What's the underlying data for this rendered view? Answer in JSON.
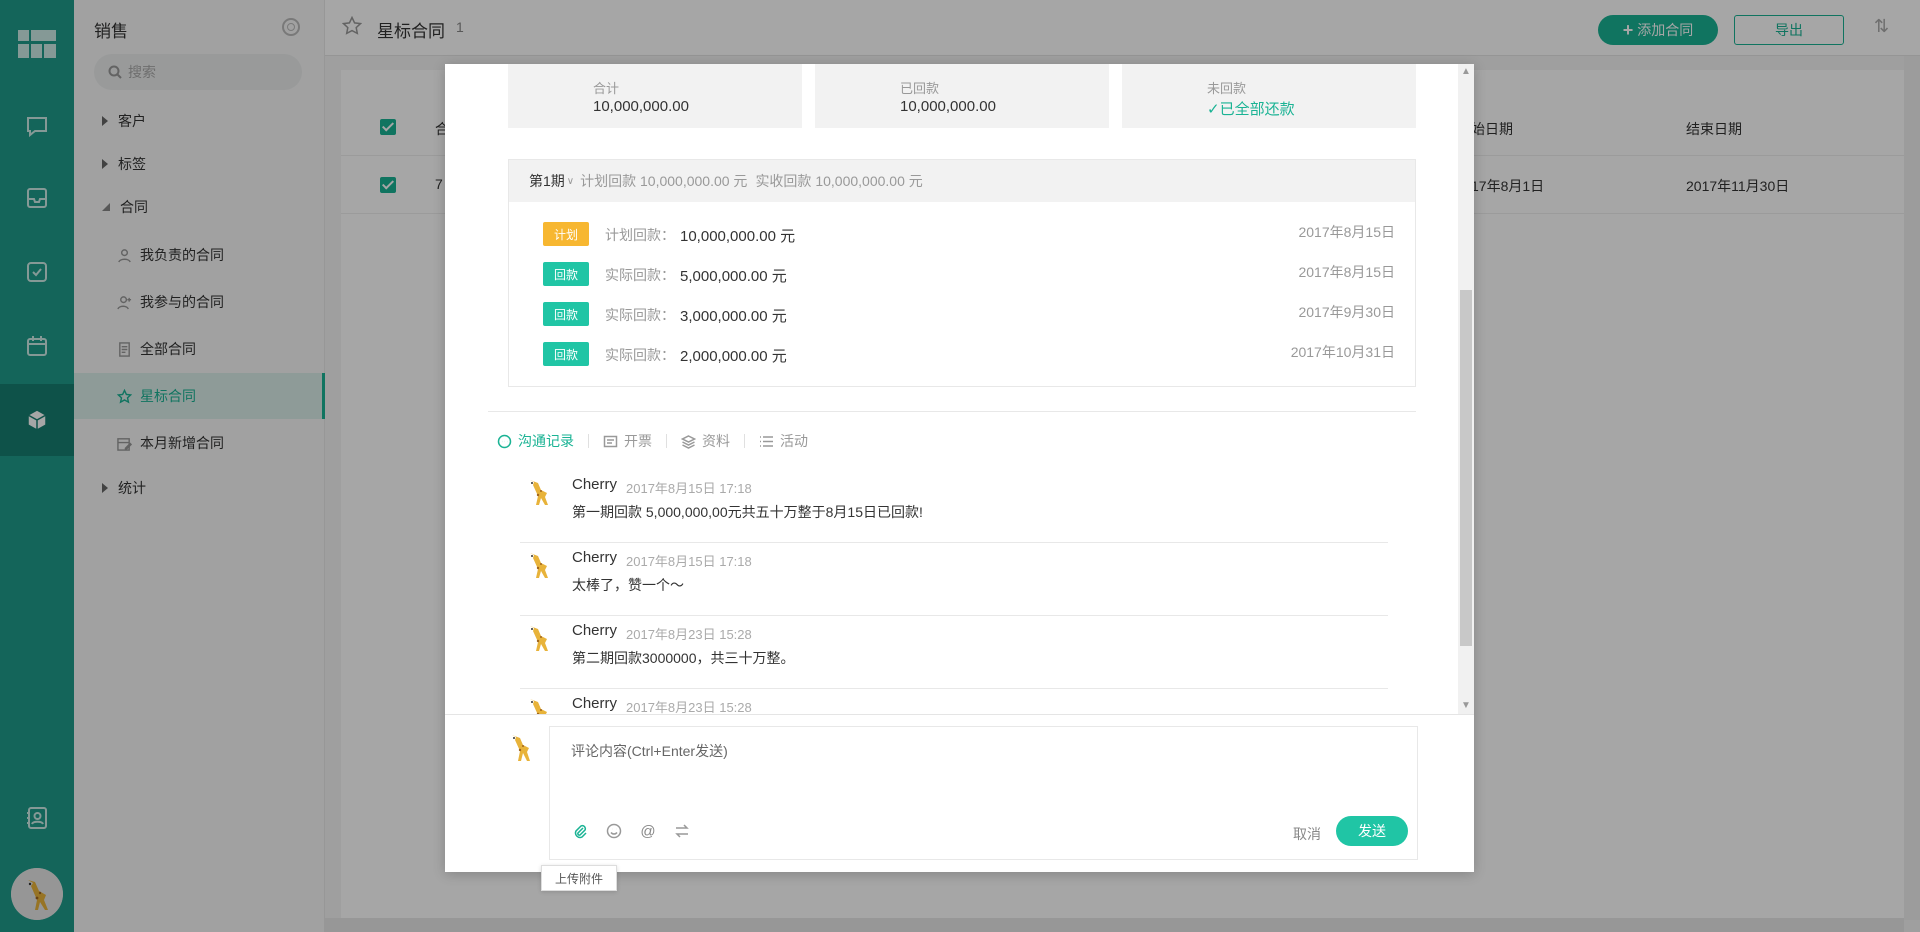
{
  "app": {
    "sidebar_title": "销售",
    "search_placeholder": "搜索"
  },
  "nav": {
    "customers": "客户",
    "tags": "标签",
    "contracts": "合同",
    "stats": "统计",
    "sub_items": [
      {
        "label": "我负责的合同",
        "icon": "user-icon"
      },
      {
        "label": "我参与的合同",
        "icon": "user-plus-icon"
      },
      {
        "label": "全部合同",
        "icon": "document-icon"
      },
      {
        "label": "星标合同",
        "icon": "star-icon"
      },
      {
        "label": "本月新增合同",
        "icon": "calendar-edit-icon"
      }
    ]
  },
  "header": {
    "title": "星标合同",
    "count": "1",
    "add_label": "添加合同",
    "export_label": "导出"
  },
  "table": {
    "col_name_partial": "合",
    "col_start_partial": "始日期",
    "col_end": "结束日期",
    "row_id_partial": "7",
    "row_start_partial": "17年8月1日",
    "row_end": "2017年11月30日"
  },
  "summary": [
    {
      "label": "合计",
      "value": "10,000,000.00"
    },
    {
      "label": "已回款",
      "value": "10,000,000.00"
    },
    {
      "label": "未回款",
      "value": "已全部还款"
    }
  ],
  "period": {
    "name": "第1期",
    "planned_text": "计划回款 10,000,000.00 元",
    "actual_text": "实收回款 10,000,000.00 元",
    "rows": [
      {
        "tag": "计划",
        "label": "计划回款：",
        "amount": "10,000,000.00 元",
        "date": "2017年8月15日"
      },
      {
        "tag": "回款",
        "label": "实际回款：",
        "amount": "5,000,000.00 元",
        "date": "2017年8月15日"
      },
      {
        "tag": "回款",
        "label": "实际回款：",
        "amount": "3,000,000.00 元",
        "date": "2017年9月30日"
      },
      {
        "tag": "回款",
        "label": "实际回款：",
        "amount": "2,000,000.00 元",
        "date": "2017年10月31日"
      }
    ]
  },
  "tabs": [
    "沟通记录",
    "开票",
    "资料",
    "活动"
  ],
  "messages": [
    {
      "author": "Cherry",
      "time": "2017年8月15日 17:18",
      "text": "第一期回款 5,000,000,00元共五十万整于8月15日已回款!"
    },
    {
      "author": "Cherry",
      "time": "2017年8月15日 17:18",
      "text": "太棒了，赞一个～"
    },
    {
      "author": "Cherry",
      "time": "2017年8月23日 15:28",
      "text": "第二期回款3000000，共三十万整。"
    },
    {
      "author": "Cherry",
      "time": "2017年8月23日 15:28",
      "text": ""
    }
  ],
  "compose": {
    "placeholder": "评论内容(Ctrl+Enter发送)",
    "cancel": "取消",
    "send": "发送",
    "tooltip": "上传附件"
  },
  "colors": {
    "brand": "#1ab394",
    "rail": "#1f9c8b",
    "plan_tag": "#f7b731",
    "pay_tag": "#20c5a5"
  }
}
